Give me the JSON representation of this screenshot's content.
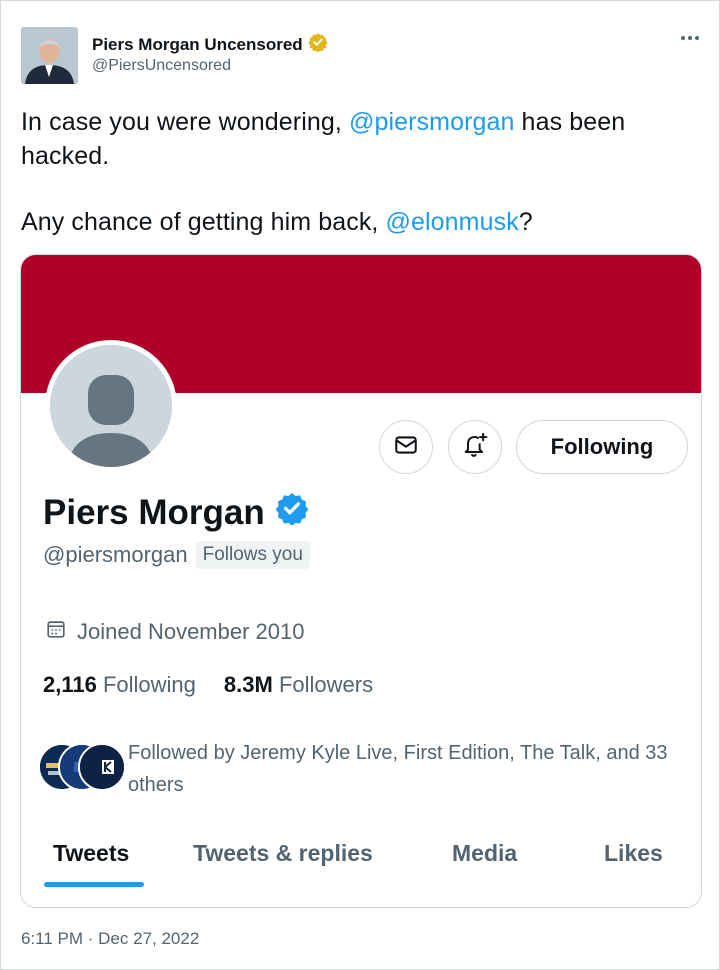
{
  "author": {
    "name": "Piers Morgan Uncensored",
    "handle": "@PiersUncensored"
  },
  "tweet": {
    "line1_before": "In case you were wondering, ",
    "line1_mention": "@piersmorgan",
    "line1_after": " has been hacked.",
    "line2_before": "Any chance of getting him back, ",
    "line2_mention": "@elonmusk",
    "line2_after": "?"
  },
  "profile_card": {
    "banner_color": "#b00028",
    "follow_button": "Following",
    "name": "Piers Morgan",
    "handle": "@piersmorgan",
    "follows_you": "Follows you",
    "joined": "Joined November 2010",
    "following_count": "2,116",
    "following_label": "Following",
    "followers_count": "8.3M",
    "followers_label": "Followers",
    "followed_by": "Followed by Jeremy Kyle Live, First Edition, The Talk, and 33 others",
    "tabs": [
      "Tweets",
      "Tweets & replies",
      "Media",
      "Likes"
    ],
    "active_tab": "Tweets"
  },
  "timestamp": "6:11 PM · Dec 27, 2022",
  "colors": {
    "accent": "#1d9bf0",
    "verified_gold": "#e2b719",
    "verified_blue": "#1d9bf0"
  },
  "icons": [
    "more-icon",
    "gold-verified-icon",
    "blue-verified-icon",
    "message-icon",
    "bell-plus-icon",
    "calendar-icon"
  ]
}
